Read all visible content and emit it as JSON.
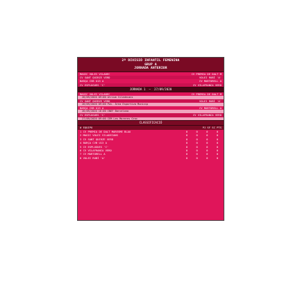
{
  "header": {
    "title": "2ª DIVISIÓ INFANTIL FEMENINA",
    "group": "GRUP A",
    "previous": "JORNADA ANTERIOR"
  },
  "previous_matches": [
    {
      "home": "MAGIC VOLEI VILADEC",
      "away": "CV PREMIA DE DALT M"
    },
    {
      "home": "CV SANT QUIRZE VERD",
      "away": "VOLEI RUBÍ 'A'"
    },
    {
      "home": "BARÇA CVB U13 A",
      "away": "CV MARTORELL A"
    },
    {
      "home": "CV ESPLUGUES 'C'",
      "away": "CV VILAFRANCA VERD"
    }
  ],
  "jornada": {
    "label": "JORNADA 1",
    "date": "27/09/2020"
  },
  "upcoming_matches": [
    {
      "home": "MAGIC VOLEI VILADEC",
      "away": "CV PREMIA DE DALT M",
      "detail": "26/09/2020 09:00 Atrium Viladecans"
    },
    {
      "home": "CV SANT QUIRZE VERD",
      "away": "VOLEI RUBÍ 'A'",
      "detail": "26/09/2020 09:00 Pav. Àrea Esportiva Municip"
    },
    {
      "home": "BARÇA CVB U13 A",
      "away": "CV MARTORELL A",
      "detail": "26/09/2020 16:00 INEF Barcelona"
    },
    {
      "home": "CV ESPLUGUES 'C'",
      "away": "CV VILAFRANCA VERD",
      "detail": "27/09/2020 09:00 CEM Les Moreres Groc"
    }
  ],
  "classification": {
    "label": "CLASSIFICACIÓ",
    "col_team": "# EQUIPO",
    "col_stats": "PJ SF SC PTS",
    "rows": [
      {
        "pos": "1",
        "name": "CV PREMIA DE DALT MARESME BLAU",
        "pj": "0",
        "sf": "0",
        "sc": "0",
        "pts": "0"
      },
      {
        "pos": "2",
        "name": "MAGIC VOLEI VILADECANS",
        "pj": "0",
        "sf": "0",
        "sc": "0",
        "pts": "0"
      },
      {
        "pos": "3",
        "name": "CV SANT QUIRZE VERD",
        "pj": "0",
        "sf": "0",
        "sc": "0",
        "pts": "0"
      },
      {
        "pos": "4",
        "name": "BARÇA CVB U13 A",
        "pj": "0",
        "sf": "0",
        "sc": "0",
        "pts": "0"
      },
      {
        "pos": "5",
        "name": "CV ESPLUGUES 'C'",
        "pj": "0",
        "sf": "0",
        "sc": "0",
        "pts": "0"
      },
      {
        "pos": "6",
        "name": "CV VILAFRANCA VERD",
        "pj": "0",
        "sf": "0",
        "sc": "0",
        "pts": "0"
      },
      {
        "pos": "7",
        "name": "CV MARTORELL A",
        "pj": "0",
        "sf": "0",
        "sc": "0",
        "pts": "0"
      },
      {
        "pos": "8",
        "name": "VOLEI RUBÍ 'A'",
        "pj": "0",
        "sf": "0",
        "sc": "0",
        "pts": "0"
      }
    ]
  },
  "colors": {
    "primary": "#e0155a",
    "header": "#7a0a24",
    "detail": "#f1a3bf"
  }
}
